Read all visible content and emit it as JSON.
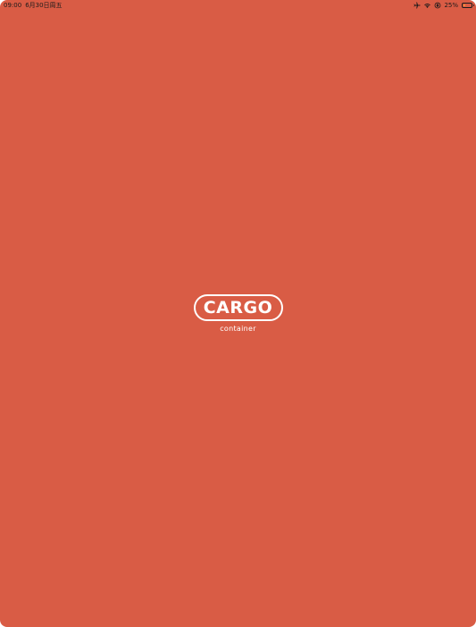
{
  "status_bar": {
    "time": "09:00",
    "date": "6月30日周五",
    "battery_percent_text": "25%",
    "battery_level": 0.25,
    "icons": [
      "airplane-icon",
      "wifi-icon",
      "orientation-lock-icon",
      "battery-icon"
    ]
  },
  "splash": {
    "logo_text": "CARGO",
    "logo_subtitle": "container"
  },
  "colors": {
    "background": "#d95c45",
    "logo": "#ffffff",
    "battery_fill": "#f0a030"
  }
}
